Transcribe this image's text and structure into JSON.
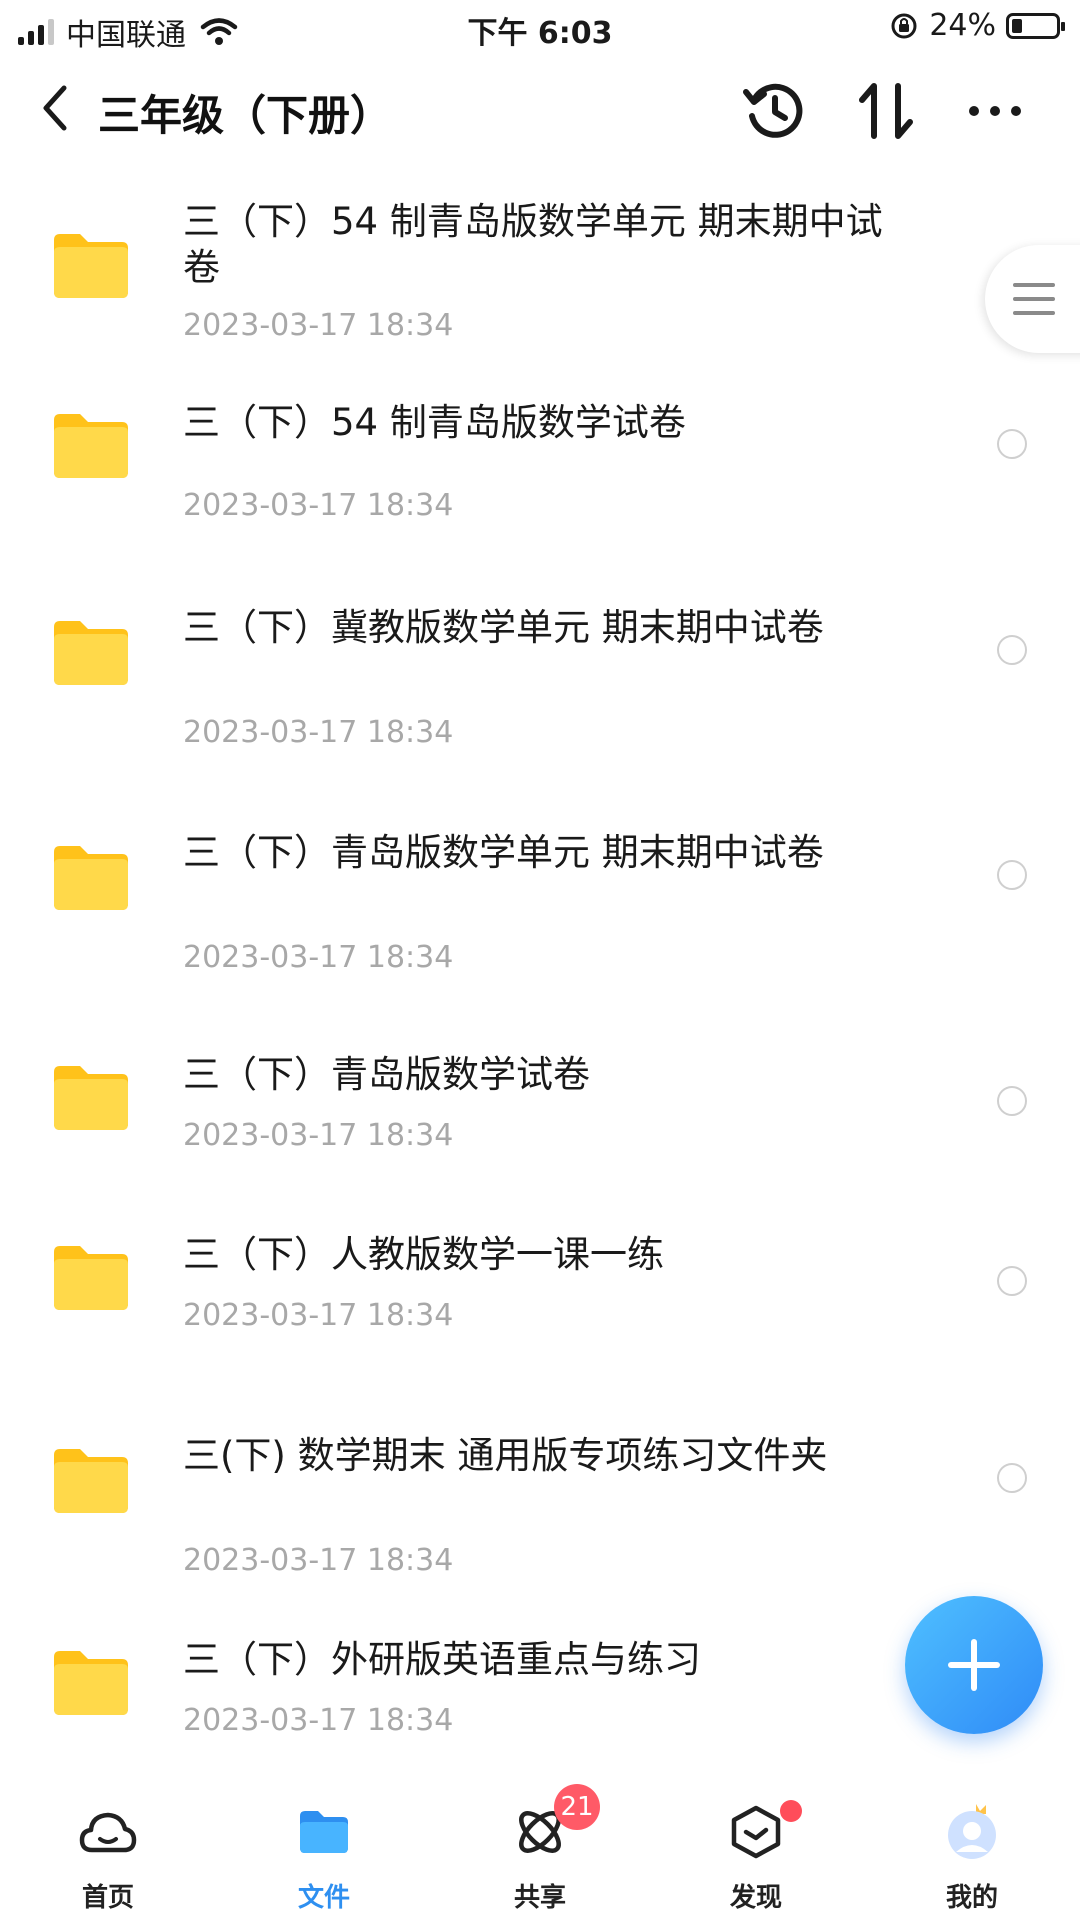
{
  "status_bar": {
    "carrier": "中国联通",
    "time": "下午 6:03",
    "battery_percent_label": "24%",
    "battery_level": 0.24
  },
  "header": {
    "title": "三年级（下册）",
    "icons": [
      "back-icon",
      "history-icon",
      "sort-icon",
      "more-icon"
    ]
  },
  "files": [
    {
      "name": "三（下）54 制青岛版数学单元 期末期中试卷",
      "date": "2023-03-17 18:34"
    },
    {
      "name": "三（下）54 制青岛版数学试卷",
      "date": "2023-03-17 18:34"
    },
    {
      "name": "三（下）冀教版数学单元 期末期中试卷",
      "date": "2023-03-17 18:34"
    },
    {
      "name": "三（下）青岛版数学单元 期末期中试卷",
      "date": "2023-03-17 18:34"
    },
    {
      "name": "三（下）青岛版数学试卷",
      "date": "2023-03-17 18:34"
    },
    {
      "name": "三（下）人教版数学一课一练",
      "date": "2023-03-17 18:34"
    },
    {
      "name": "三(下) 数学期末 通用版专项练习文件夹",
      "date": "2023-03-17 18:34"
    },
    {
      "name": "三（下）外研版英语重点与练习",
      "date": "2023-03-17 18:34"
    }
  ],
  "bottom_nav": {
    "tabs": [
      {
        "label": "首页",
        "icon": "home-cloud-icon"
      },
      {
        "label": "文件",
        "icon": "folder-icon",
        "active": true
      },
      {
        "label": "共享",
        "icon": "share-atom-icon",
        "badge": "21"
      },
      {
        "label": "发现",
        "icon": "discover-cube-icon",
        "dot": true
      },
      {
        "label": "我的",
        "icon": "avatar-icon"
      }
    ]
  },
  "colors": {
    "accent": "#2e8ff0",
    "folder": "#ffd23f",
    "date_text": "#a8a8a8",
    "badge": "#ff5a67"
  }
}
